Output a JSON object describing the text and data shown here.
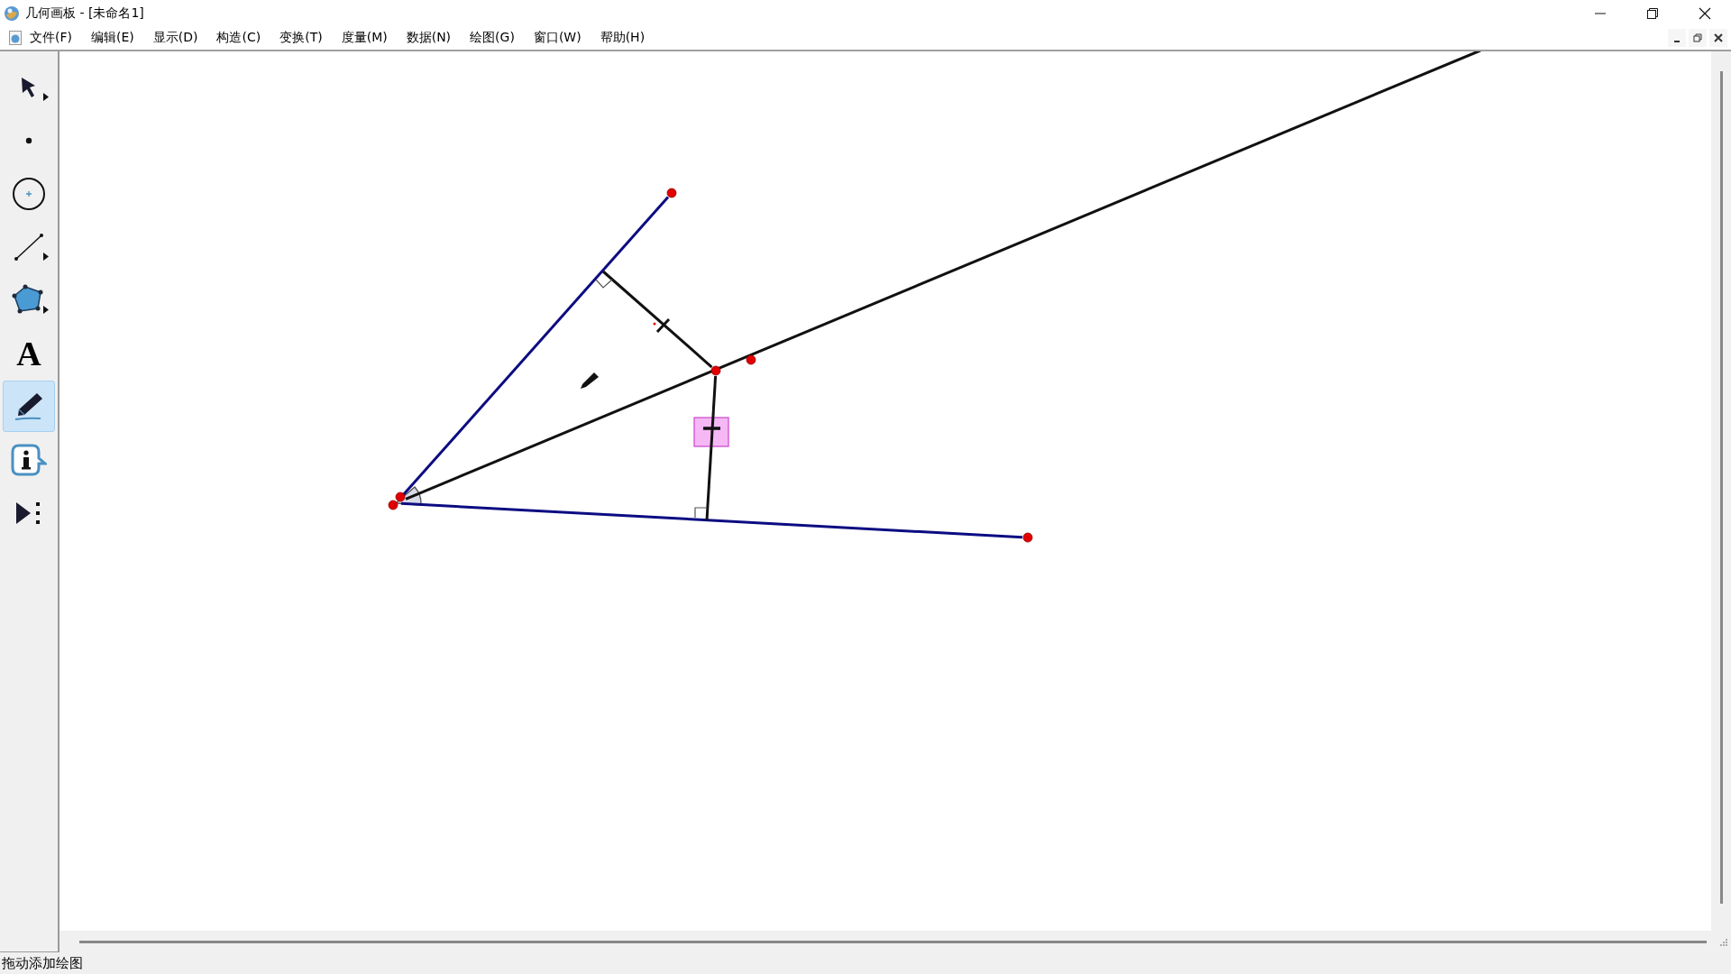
{
  "window": {
    "title": "几何画板 - [未命名1]"
  },
  "menu": [
    "文件(F)",
    "编辑(E)",
    "显示(D)",
    "构造(C)",
    "变换(T)",
    "度量(M)",
    "数据(N)",
    "绘图(G)",
    "窗口(W)",
    "帮助(H)"
  ],
  "toolbox": [
    {
      "kind": "arrow",
      "submenu": true,
      "selected": false
    },
    {
      "kind": "point",
      "submenu": false,
      "selected": false
    },
    {
      "kind": "compass",
      "submenu": false,
      "selected": false
    },
    {
      "kind": "straightedge",
      "submenu": true,
      "selected": false
    },
    {
      "kind": "polygon",
      "submenu": true,
      "selected": false
    },
    {
      "kind": "text",
      "glyph": "A",
      "submenu": false,
      "selected": false
    },
    {
      "kind": "marker",
      "submenu": false,
      "selected": true
    },
    {
      "kind": "info",
      "submenu": false,
      "selected": false
    },
    {
      "kind": "custom",
      "submenu": false,
      "selected": false
    }
  ],
  "status_bar": "拖动添加绘图"
}
